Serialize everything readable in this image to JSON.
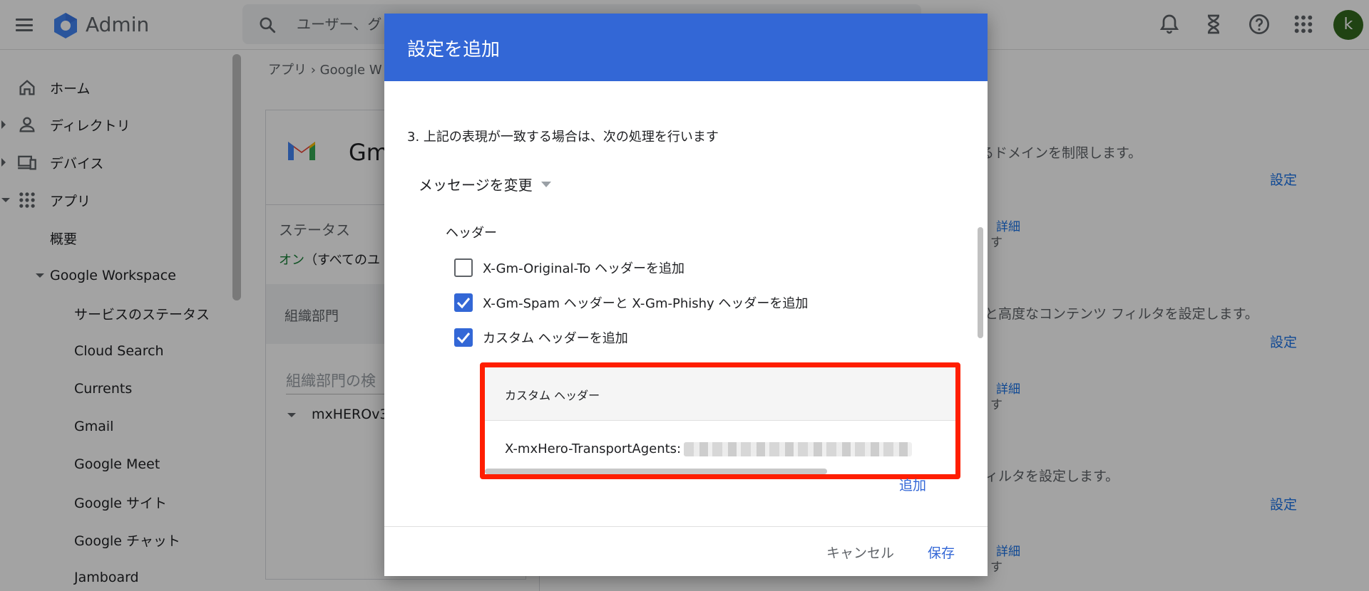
{
  "topbar": {
    "brand": "Admin",
    "search_placeholder": "ユーザー、グ",
    "avatar_letter": "k"
  },
  "sidebar": {
    "items": [
      {
        "label": "ホーム",
        "icon": "home-icon"
      },
      {
        "label": "ディレクトリ",
        "icon": "person-icon"
      },
      {
        "label": "デバイス",
        "icon": "devices-icon"
      },
      {
        "label": "アプリ",
        "icon": "apps-icon"
      },
      {
        "label": "概要"
      },
      {
        "label": "Google Workspace"
      },
      {
        "label": "サービスのステータス"
      },
      {
        "label": "Cloud Search"
      },
      {
        "label": "Currents"
      },
      {
        "label": "Gmail"
      },
      {
        "label": "Google Meet"
      },
      {
        "label": "Google サイト"
      },
      {
        "label": "Google チャット"
      },
      {
        "label": "Jamboard"
      }
    ]
  },
  "main": {
    "breadcrumb": "アプリ  ›  Google W",
    "card": {
      "title": "Gm",
      "status_label": "ステータス",
      "status_on": "オン",
      "status_rest": "（すべてのユ",
      "org_header": "組織部門",
      "org_search_placeholder": "組織部門の検",
      "org_item": "mxHEROv3"
    },
    "right": {
      "desc1": "るドメインを制限します。",
      "link_setting": "設定",
      "link_detail": "詳細",
      "suffix_su": "す",
      "desc2": "と高度なコンテンツ フィルタを設定します。",
      "desc3": "ィルタを設定します。"
    }
  },
  "dialog": {
    "title": "設定を追加",
    "step": "3. 上記の表現が一致する場合は、次の処理を行います",
    "action": "メッセージを変更",
    "headers_label": "ヘッダー",
    "checkboxes": [
      {
        "label": "X-Gm-Original-To ヘッダーを追加",
        "checked": false
      },
      {
        "label": "X-Gm-Spam ヘッダーと X-Gm-Phishy ヘッダーを追加",
        "checked": true
      },
      {
        "label": "カスタム ヘッダーを追加",
        "checked": true
      }
    ],
    "custom_headers_title": "カスタム ヘッダー",
    "custom_header_value": "X-mxHero-TransportAgents:",
    "add_label": "追加",
    "cancel_label": "キャンセル",
    "save_label": "保存"
  },
  "colors": {
    "dialog_header": "#3367d6",
    "highlight_border": "#ff1e00",
    "link": "#1a73e8",
    "status_on": "#188038",
    "avatar": "#33691e"
  }
}
